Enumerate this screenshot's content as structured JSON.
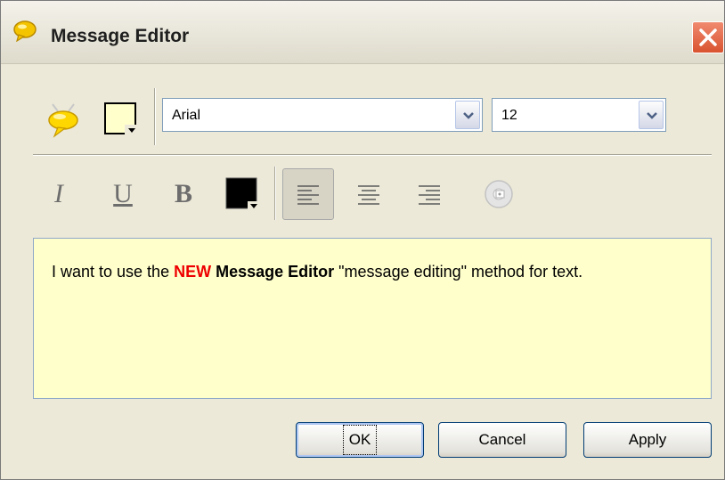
{
  "window": {
    "title": "Message Editor"
  },
  "toolbar": {
    "font": {
      "selected": "Arial"
    },
    "size": {
      "selected": "12"
    }
  },
  "format": {
    "italic": "I",
    "underline": "U",
    "bold": "B"
  },
  "editor": {
    "text_before": "I want to use the ",
    "text_new": "NEW",
    "text_space": " ",
    "text_bold": "Message Editor",
    "text_after": " \"message editing\" method for text."
  },
  "buttons": {
    "ok": "OK",
    "cancel": "Cancel",
    "apply": "Apply"
  },
  "colors": {
    "editor_background": "#ffffcc",
    "highlight_red": "#ee0000",
    "dialog_background": "#ece9d8",
    "close_red": "#d9532f"
  }
}
